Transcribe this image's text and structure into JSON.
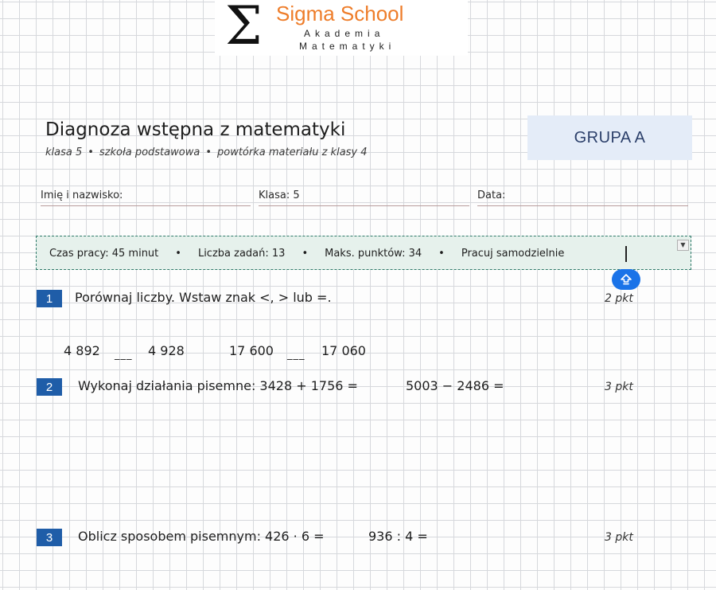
{
  "logo": {
    "symbol": "Σ",
    "name": "Sigma School",
    "line1": "Akademia",
    "line2": "Matematyki"
  },
  "header": {
    "title": "Diagnoza wstępna z matematyki",
    "subtitle_parts": [
      "klasa 5",
      "szkoła podstawowa",
      "powtórka materiału z klasy 4"
    ],
    "separator": "•",
    "group": "GRUPA A"
  },
  "fields": {
    "name_label": "Imię i nazwisko:",
    "class_label": "Klasa: 5",
    "date_label": "Data:"
  },
  "info": {
    "time": "Czas pracy: 45 minut",
    "tasks": "Liczba zadań: 13",
    "points": "Maks. punktów: 34",
    "note": "Pracuj samodzielnie",
    "separator": "•"
  },
  "icons": {
    "dropdown": "dropdown-arrow-icon",
    "fab": "shift-arrow-icon"
  },
  "colors": {
    "brand": "#ee7d2a",
    "badge": "#1f5da8",
    "info_border": "#2f7a6a",
    "info_bg": "#e6f1ec",
    "group_bg": "#e4ecf8",
    "fab": "#1a73e8"
  },
  "tasks": [
    {
      "number": "1",
      "text": "Porównaj liczby. Wstaw znak <, > lub =.",
      "points": "2 pkt",
      "comparisons": [
        {
          "left": "4 892",
          "blank": "___",
          "right": "4 928"
        },
        {
          "left": "17 600",
          "blank": "___",
          "right": "17 060"
        }
      ]
    },
    {
      "number": "2",
      "text": "Wykonaj działania pisemne: 3428 + 1756 =",
      "extra": "5003 − 2486 =",
      "points": "3 pkt"
    },
    {
      "number": "3",
      "text": "Oblicz sposobem pisemnym: 426 · 6 =",
      "extra": "936 : 4 =",
      "points": "3 pkt"
    }
  ]
}
